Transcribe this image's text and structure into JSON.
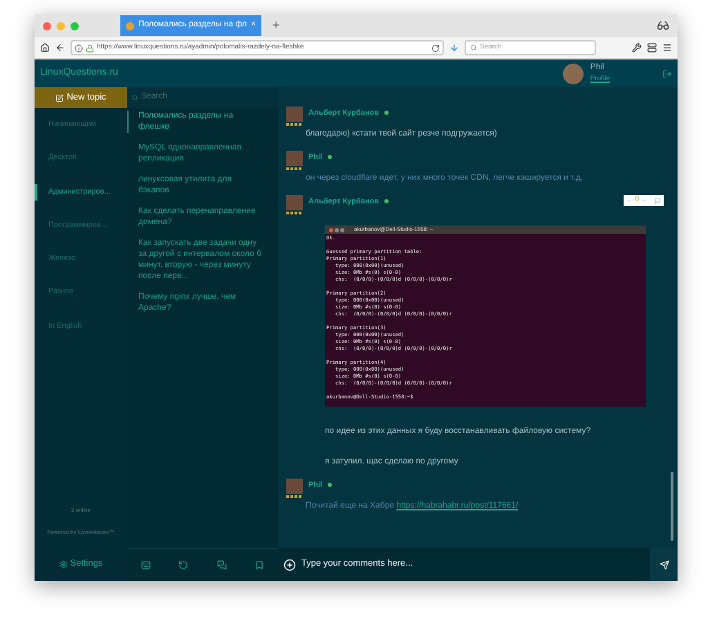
{
  "browser": {
    "tab_title": "Поломались разделы на фл",
    "tab_close": "×",
    "new_tab": "+",
    "url": "https://www.linuxquestions.ru/ayadmin/polomalis-razdely-na-fleshke",
    "search_placeholder": "Search"
  },
  "header": {
    "site_title": "LinuxQuestions.ru",
    "user_name": "Phil",
    "profile_link": "Profile"
  },
  "sidebar": {
    "new_topic": "New topic",
    "categories": [
      {
        "label": "Начинающим",
        "selected": false
      },
      {
        "label": "Десктоп",
        "selected": false
      },
      {
        "label": "Администриров...",
        "selected": true
      },
      {
        "label": "Программиров...",
        "selected": false
      },
      {
        "label": "Железо",
        "selected": false
      },
      {
        "label": "Разное",
        "selected": false
      },
      {
        "label": "In English",
        "selected": false
      }
    ],
    "online_count": "2 online",
    "powered_by": "Powered by Livewebcore™",
    "settings": "Settings"
  },
  "topics": {
    "search_placeholder": "Search",
    "items": [
      {
        "title": "Поломались разделы на флешке",
        "selected": true
      },
      {
        "title": "MySQL однонаправленная репликация",
        "selected": false
      },
      {
        "title": "линуксовая утилита для бэкапов",
        "selected": false
      },
      {
        "title": "Как сделать перенаправление домена?",
        "selected": false
      },
      {
        "title": "Как запускать две задачи одну за другой с интервалом около 6 минут, вторую - через минуту после перв...",
        "selected": false
      },
      {
        "title": "Почему nginx лучше, чем Apache?",
        "selected": false
      }
    ]
  },
  "messages": [
    {
      "author": "Альберт Курбанов",
      "online": true,
      "paragraphs": [
        {
          "text": "благодарю) кстати твой сайт резче подгружается)",
          "dim": false
        }
      ]
    },
    {
      "author": "Phil",
      "online": true,
      "paragraphs": [
        {
          "text": "он через cloudflare идет, у них много точек CDN, легче кэшируется и т.д.",
          "dim": true
        }
      ]
    },
    {
      "author": "Альберт Курбанов",
      "online": true,
      "votes": "0",
      "terminal": {
        "title": "akurbanov@Dell-Studio-1558: ~",
        "blocks": [
          [
            "Ok."
          ],
          [
            "Guessed primary partition table:",
            "Primary partition(1)",
            "   type: 000(0x00)(unused)",
            "   size: 0Mb #s(0) s(0-0)",
            "   chs:  (0/0/0)-(0/0/0)d (0/0/0)-(0/0/0)r"
          ],
          [
            "Primary partition(2)",
            "   type: 000(0x00)(unused)",
            "   size: 0Mb #s(0) s(0-0)",
            "   chs:  (0/0/0)-(0/0/0)d (0/0/0)-(0/0/0)r"
          ],
          [
            "Primary partition(3)",
            "   type: 000(0x00)(unused)",
            "   size: 0Mb #s(0) s(0-0)",
            "   chs:  (0/0/0)-(0/0/0)d (0/0/0)-(0/0/0)r"
          ],
          [
            "Primary partition(4)",
            "   type: 000(0x00)(unused)",
            "   size: 0Mb #s(0) s(0-0)",
            "   chs:  (0/0/0)-(0/0/0)d (0/0/0)-(0/0/0)r"
          ],
          [
            "akurbanov@Dell-Studio-1558:~$"
          ]
        ]
      },
      "paragraphs": [
        {
          "text": "по идее из этих данных я буду восстанавливать файловую систему?",
          "dim": false
        },
        {
          "text": "я затупил. щас сделаю по другому",
          "dim": false
        }
      ]
    },
    {
      "author": "Phil",
      "online": true,
      "paragraphs": [
        {
          "text": "Почитай еще на Хабре",
          "dim": true,
          "link": "https://habrahabr.ru/post/117661/"
        }
      ]
    }
  ],
  "composer": {
    "placeholder": "Type your comments here..."
  }
}
